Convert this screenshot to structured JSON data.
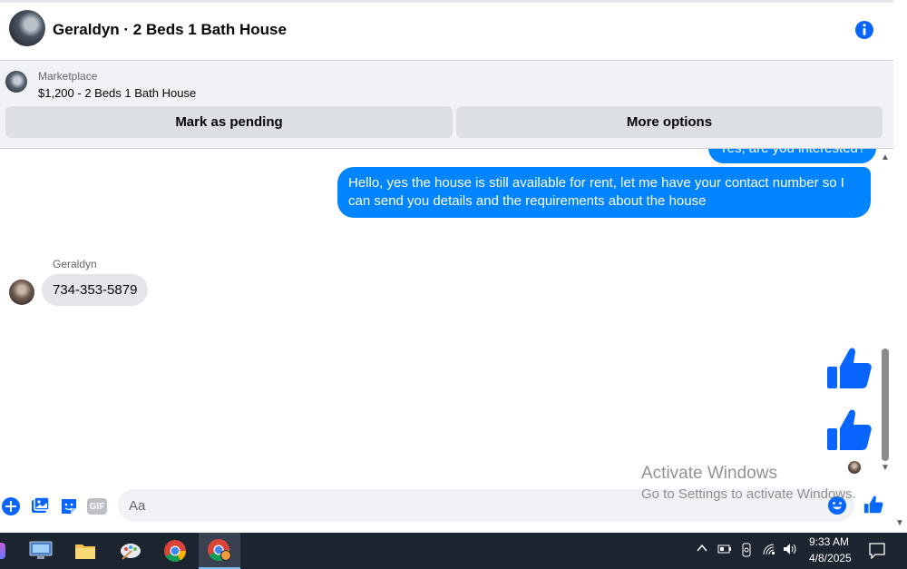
{
  "header": {
    "title": "Geraldyn · 2 Beds 1 Bath House",
    "info_icon": "info-icon"
  },
  "listing": {
    "source_label": "Marketplace",
    "price_title": "$1,200 - 2 Beds 1 Bath House",
    "primary_action": "Mark as pending",
    "secondary_action": "More options"
  },
  "messages": {
    "partial_outgoing": "Yes, are you interested?",
    "outgoing_main": "Hello, yes the house is still available for rent, let me have your contact number so I can send you details and the requirements about the house",
    "incoming_sender": "Geraldyn",
    "incoming_text": "734-353-5879",
    "reactions": [
      "thumbs-up-icon",
      "thumbs-up-icon"
    ]
  },
  "composer": {
    "placeholder": "Aa",
    "icons": [
      "plus-icon",
      "image-icon",
      "sticker-icon",
      "gif-icon",
      "emoji-icon",
      "like-icon"
    ],
    "gif_text": "GIF"
  },
  "watermark": {
    "line1": "Activate Windows",
    "line2": "Go to Settings to activate Windows."
  },
  "taskbar": {
    "time": "9:33 AM",
    "date": "4/8/2025"
  },
  "colors": {
    "accent": "#0084ff",
    "incoming_bubble": "#e4e6eb",
    "panel_bg": "#f0f2f5",
    "taskbar_bg": "#1c2430"
  }
}
